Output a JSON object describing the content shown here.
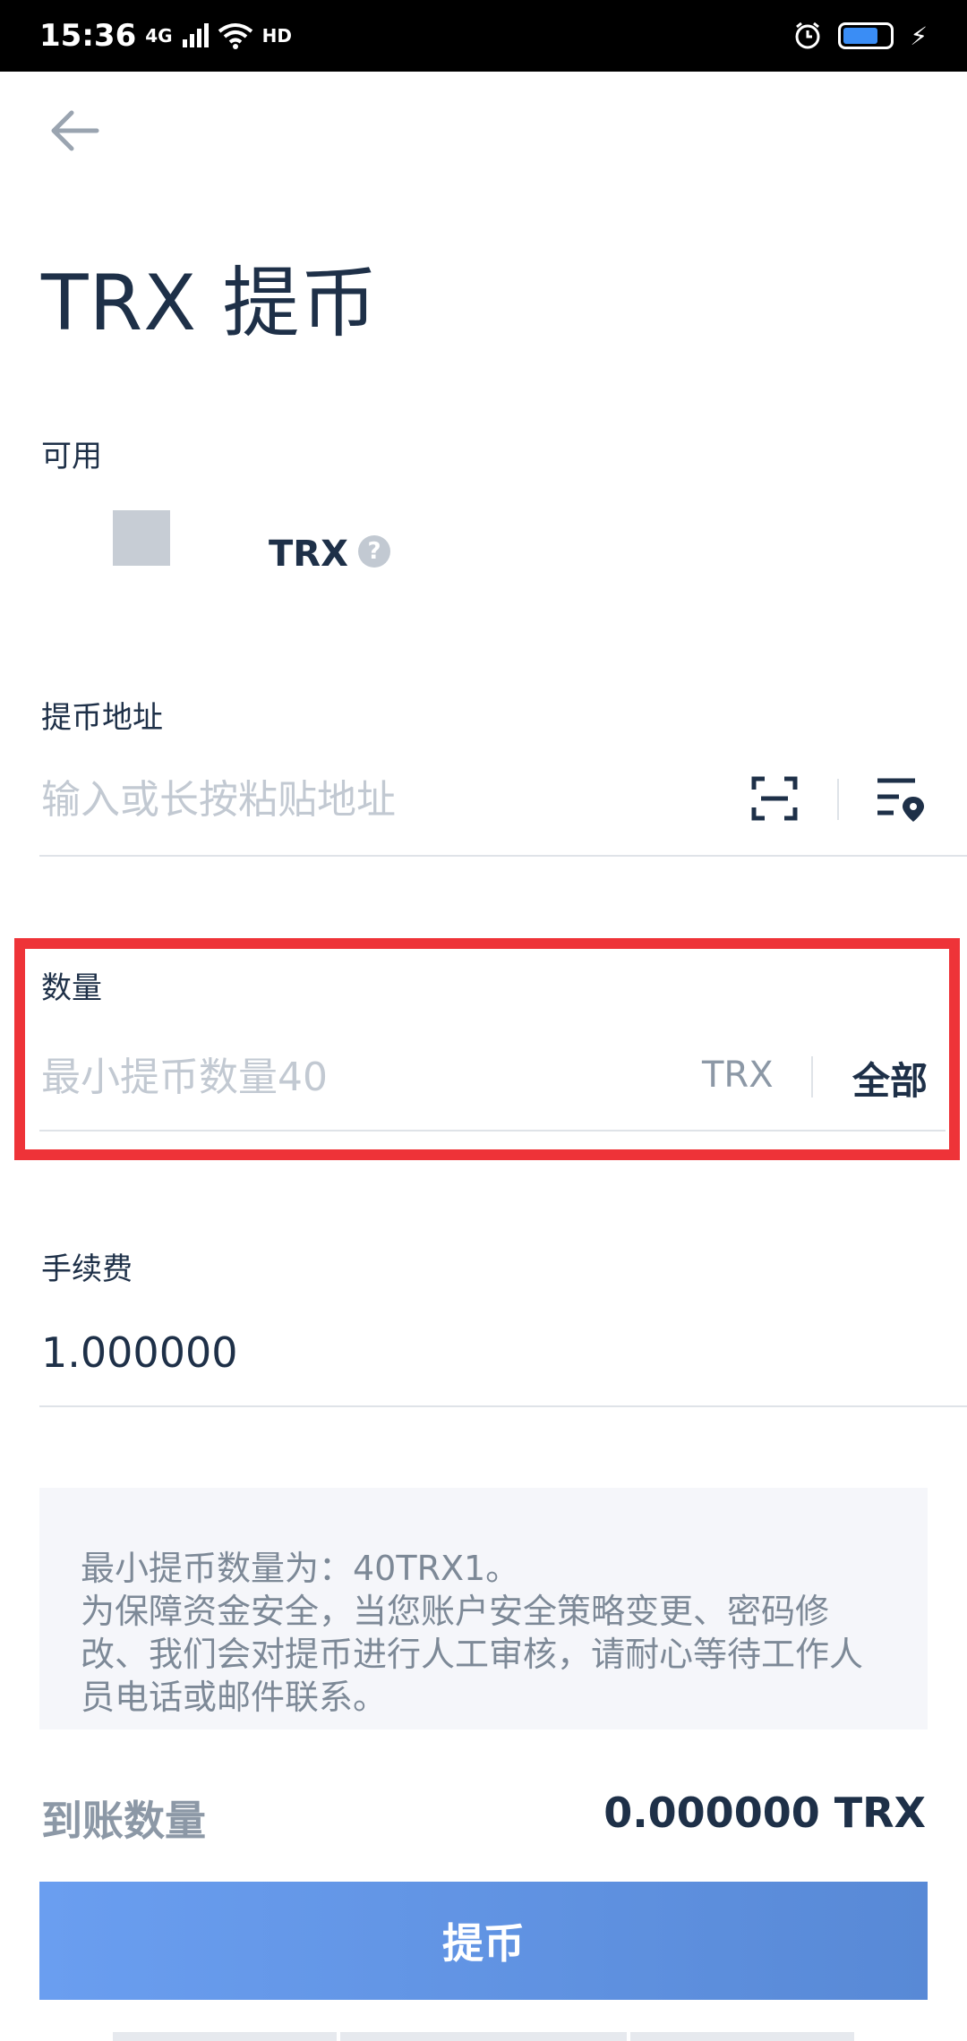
{
  "status_bar": {
    "time": "15:36",
    "network": "4G",
    "hd": "HD",
    "charging_symbol": "⚡",
    "battery_level": 0.75
  },
  "header": {
    "back_icon": "arrow-left-icon",
    "title": "TRX 提币"
  },
  "available": {
    "label": "可用",
    "unit": "TRX",
    "help_symbol": "?"
  },
  "address": {
    "label": "提币地址",
    "placeholder": "输入或长按粘贴地址",
    "scan_icon": "scan-icon",
    "address_book_icon": "address-book-icon"
  },
  "amount": {
    "label": "数量",
    "placeholder": "最小提币数量40",
    "unit": "TRX",
    "all_label": "全部"
  },
  "fee": {
    "label": "手续费",
    "value": "1.000000"
  },
  "notice": {
    "lines": [
      "最小提币数量为：40TRX1。",
      "为保障资金安全，当您账户安全策略变更、密码修改、我们会对提币进行人工审核，请耐心等待工作人员电话或邮件联系。"
    ]
  },
  "receive": {
    "label": "到账数量",
    "value": "0.000000 TRX"
  },
  "submit": {
    "label": "提币"
  },
  "colors": {
    "highlight": "#ee3338",
    "button_start": "#6a9ef0",
    "button_end": "#5889d6",
    "text_dark": "#1e3048",
    "placeholder": "#c2c9d2"
  }
}
